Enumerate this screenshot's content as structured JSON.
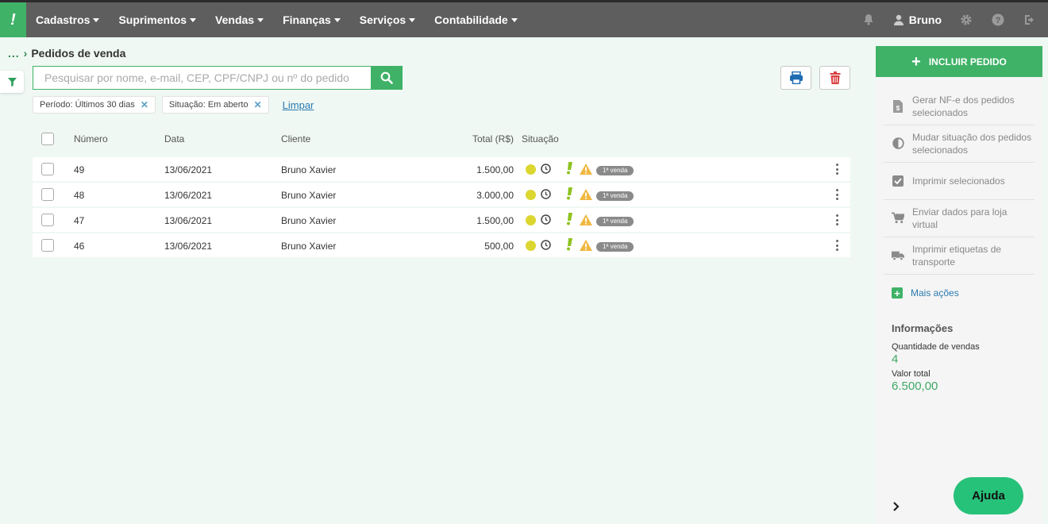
{
  "nav": {
    "logo_glyph": "!",
    "menu": [
      {
        "label": "Cadastros"
      },
      {
        "label": "Suprimentos"
      },
      {
        "label": "Vendas"
      },
      {
        "label": "Finanças"
      },
      {
        "label": "Serviços"
      },
      {
        "label": "Contabilidade"
      }
    ],
    "user_name": "Bruno",
    "icons": [
      "bell-icon",
      "user-icon",
      "gear-icon",
      "help-icon",
      "logout-icon"
    ]
  },
  "breadcrumb": {
    "dots": "...",
    "title": "Pedidos de venda"
  },
  "search": {
    "placeholder": "Pesquisar por nome, e-mail, CEP, CPF/CNPJ ou nº do pedido",
    "value": ""
  },
  "filters": {
    "chips": [
      {
        "label": "Período: Últimos 30 dias"
      },
      {
        "label": "Situação: Em aberto"
      }
    ],
    "clear_label": "Limpar"
  },
  "table": {
    "headers": {
      "numero": "Número",
      "data": "Data",
      "cliente": "Cliente",
      "total": "Total (R$)",
      "situacao": "Situação"
    },
    "rows": [
      {
        "numero": "49",
        "data": "13/06/2021",
        "cliente": "Bruno Xavier",
        "total": "1.500,00",
        "badge": "1ª venda"
      },
      {
        "numero": "48",
        "data": "13/06/2021",
        "cliente": "Bruno Xavier",
        "total": "3.000,00",
        "badge": "1ª venda"
      },
      {
        "numero": "47",
        "data": "13/06/2021",
        "cliente": "Bruno Xavier",
        "total": "1.500,00",
        "badge": "1ª venda"
      },
      {
        "numero": "46",
        "data": "13/06/2021",
        "cliente": "Bruno Xavier",
        "total": "500,00",
        "badge": "1ª venda"
      }
    ]
  },
  "panel": {
    "incluir_label": "INCLUIR PEDIDO",
    "actions": [
      {
        "label": "Gerar NF-e dos pedidos selecionados",
        "icon": "document-dollar-icon"
      },
      {
        "label": "Mudar situação dos pedidos selecionados",
        "icon": "half-circle-icon"
      },
      {
        "label": "Imprimir selecionados",
        "icon": "checkbox-icon"
      },
      {
        "label": "Enviar dados para loja virtual",
        "icon": "cart-icon"
      },
      {
        "label": "Imprimir etiquetas de transporte",
        "icon": "truck-icon"
      }
    ],
    "mais_acoes": "Mais ações",
    "info": {
      "title": "Informações",
      "qty_label": "Quantidade de vendas",
      "qty_value": "4",
      "total_label": "Valor total",
      "total_value": "6.500,00"
    }
  },
  "help": {
    "label": "Ajuda"
  },
  "colors": {
    "brand_green": "#3fb267",
    "nav_gray": "#5e5e5e",
    "status_yellow": "#dcd631",
    "link_blue": "#2a7ab0"
  }
}
